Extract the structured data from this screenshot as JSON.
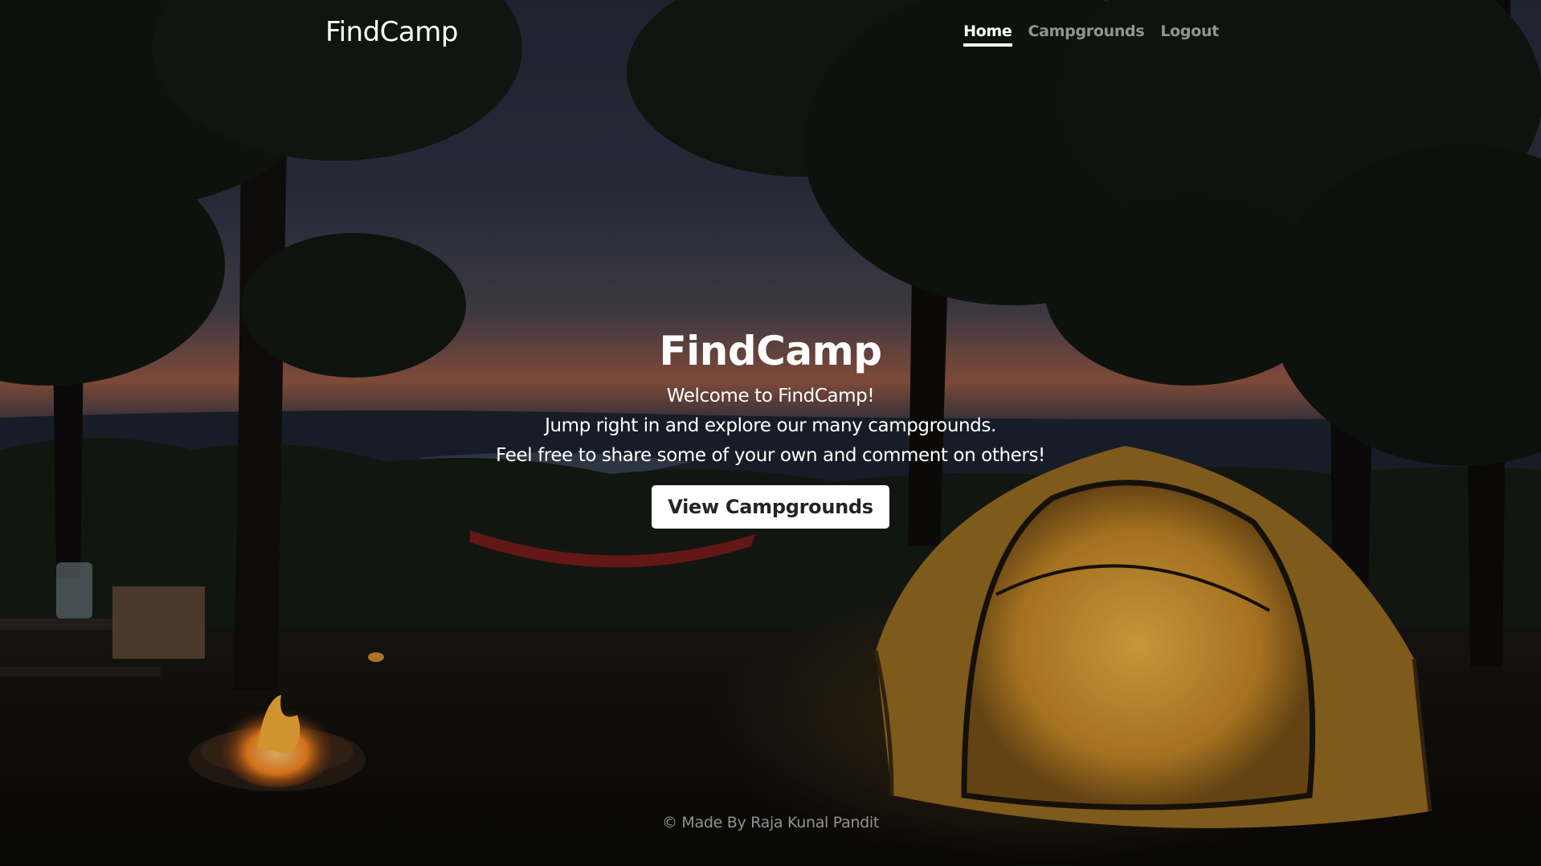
{
  "navbar": {
    "brand": "FindCamp",
    "links": [
      {
        "label": "Home",
        "active": true
      },
      {
        "label": "Campgrounds",
        "active": false
      },
      {
        "label": "Logout",
        "active": false
      }
    ]
  },
  "hero": {
    "title": "FindCamp",
    "lines": [
      "Welcome to FindCamp!",
      "Jump right in and explore our many campgrounds.",
      "Feel free to share some of your own and comment on others!"
    ],
    "button_label": "View Campgrounds"
  },
  "footer": {
    "text": "© Made By Raja Kunal Pandit"
  },
  "colors": {
    "overlay": "#000000",
    "button_bg": "#ffffff",
    "button_text": "#212529",
    "tent": "#e0a636"
  }
}
